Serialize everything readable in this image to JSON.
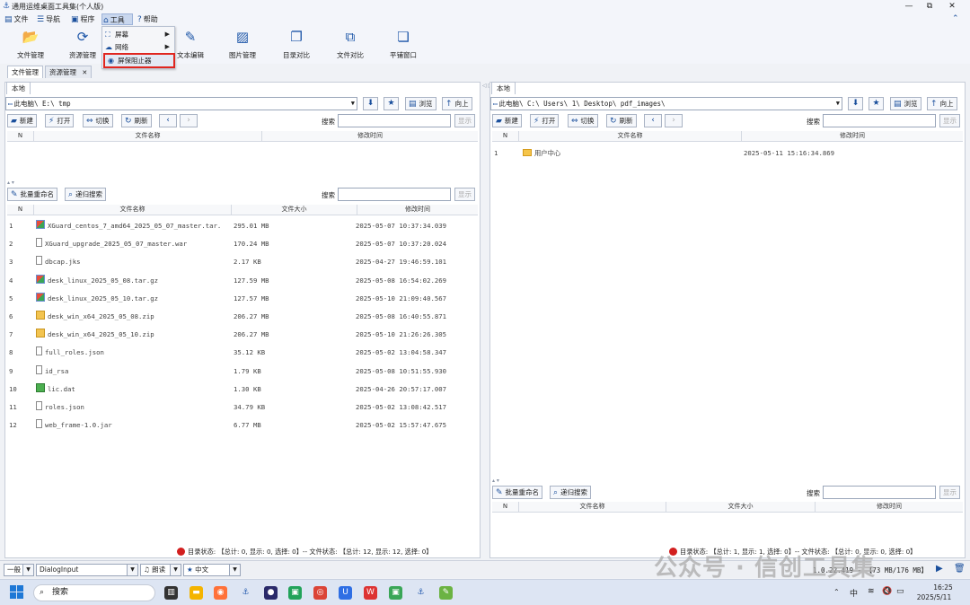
{
  "window": {
    "title": "通用运维桌面工具集(个人版)",
    "controls": [
      "—",
      "⧉",
      "✕"
    ]
  },
  "menubar": {
    "items": [
      {
        "label": "文件",
        "icon": "file-icon"
      },
      {
        "label": "导航",
        "icon": "list-icon"
      },
      {
        "label": "程序",
        "icon": "program-icon"
      },
      {
        "label": "工具",
        "icon": "tools-icon"
      },
      {
        "label": "帮助",
        "icon": "help-icon"
      }
    ]
  },
  "toolbar": {
    "items": [
      {
        "label": "文件管理",
        "icon": "folder-icon"
      },
      {
        "label": "资源管理",
        "icon": "resource-icon"
      },
      {
        "label": "文本编辑",
        "icon": "edit-icon"
      },
      {
        "label": "图片管理",
        "icon": "image-icon"
      },
      {
        "label": "目录对比",
        "icon": "dir-compare-icon"
      },
      {
        "label": "文件对比",
        "icon": "file-compare-icon"
      },
      {
        "label": "平铺窗口",
        "icon": "tile-window-icon"
      }
    ]
  },
  "dropdown": {
    "items": [
      {
        "label": "屏幕",
        "has_submenu": true
      },
      {
        "label": "网络",
        "has_submenu": true
      },
      {
        "label": "屏保阻止器",
        "has_submenu": false,
        "highlighted": true
      }
    ]
  },
  "tabs": [
    {
      "label": "文件管理",
      "selected": true
    },
    {
      "label": "资源管理",
      "closable": true
    }
  ],
  "left": {
    "subtab": "本地",
    "path": "此电脑\\ E:\\ tmp",
    "nav_buttons": {
      "browse": "浏览",
      "up": "向上"
    },
    "actions": {
      "new": "新建",
      "open": "打开",
      "switch": "切换",
      "refresh": "刷新"
    },
    "search_label": "搜索",
    "show_btn": "显示",
    "dir_header": {
      "n": "N",
      "name": "文件名称",
      "mtime": "修改时间"
    },
    "bottom_actions": {
      "rename": "批量重命名",
      "recursive": "递归搜索"
    },
    "file_header": {
      "n": "N",
      "name": "文件名称",
      "size": "文件大小",
      "mtime": "修改时间"
    },
    "files": [
      {
        "n": "1",
        "name": "XGuard_centos_7_amd64_2025_05_07_master.tar.",
        "size": "295.01 MB",
        "mtime": "2025-05-07 10:37:34.039",
        "type": "zip"
      },
      {
        "n": "2",
        "name": "XGuard_upgrade_2025_05_07_master.war",
        "size": "170.24 MB",
        "mtime": "2025-05-07 10:37:20.024",
        "type": "file"
      },
      {
        "n": "3",
        "name": "dbcap.jks",
        "size": "2.17 KB",
        "mtime": "2025-04-27 19:46:59.101",
        "type": "file"
      },
      {
        "n": "4",
        "name": "desk_linux_2025_05_08.tar.gz",
        "size": "127.59 MB",
        "mtime": "2025-05-08 16:54:02.269",
        "type": "zip"
      },
      {
        "n": "5",
        "name": "desk_linux_2025_05_10.tar.gz",
        "size": "127.57 MB",
        "mtime": "2025-05-10 21:09:40.567",
        "type": "zip"
      },
      {
        "n": "6",
        "name": "desk_win_x64_2025_05_08.zip",
        "size": "206.27 MB",
        "mtime": "2025-05-08 16:40:55.871",
        "type": "gz"
      },
      {
        "n": "7",
        "name": "desk_win_x64_2025_05_10.zip",
        "size": "206.27 MB",
        "mtime": "2025-05-10 21:26:26.305",
        "type": "gz"
      },
      {
        "n": "8",
        "name": "full_roles.json",
        "size": "35.12 KB",
        "mtime": "2025-05-02 13:04:58.347",
        "type": "file"
      },
      {
        "n": "9",
        "name": "id_rsa",
        "size": "1.79 KB",
        "mtime": "2025-05-08 10:51:55.930",
        "type": "file"
      },
      {
        "n": "10",
        "name": "lic.dat",
        "size": "1.30 KB",
        "mtime": "2025-04-26 20:57:17.007",
        "type": "dat"
      },
      {
        "n": "11",
        "name": "roles.json",
        "size": "34.79 KB",
        "mtime": "2025-05-02 13:08:42.517",
        "type": "file"
      },
      {
        "n": "12",
        "name": "web_frame-1.0.jar",
        "size": "6.77 MB",
        "mtime": "2025-05-02 15:57:47.675",
        "type": "file"
      }
    ],
    "status": "目录状态: 【总计: 0, 显示: 0, 选择: 0】-- 文件状态: 【总计: 12, 显示: 12, 选择: 0】"
  },
  "right": {
    "subtab": "本地",
    "path": "此电脑\\ C:\\ Users\\ 1\\ Desktop\\ pdf_images\\",
    "nav_buttons": {
      "browse": "浏览",
      "up": "向上"
    },
    "actions": {
      "new": "新建",
      "open": "打开",
      "switch": "切换",
      "refresh": "刷新"
    },
    "search_label": "搜索",
    "show_btn": "显示",
    "dir_header": {
      "n": "N",
      "name": "文件名称",
      "mtime": "修改时间"
    },
    "dirs": [
      {
        "n": "1",
        "name": "用户中心",
        "mtime": "2025-05-11 15:16:34.869"
      }
    ],
    "bottom_actions": {
      "rename": "批量重命名",
      "recursive": "递归搜索"
    },
    "file_header": {
      "n": "N",
      "name": "文件名称",
      "size": "文件大小",
      "mtime": "修改时间"
    },
    "status": "目录状态: 【总计: 1, 显示: 1, 选择: 0】-- 文件状态: 【总计: 0, 显示: 0, 选择: 0】"
  },
  "bottombar": {
    "level": "一般",
    "input": "DialogInput",
    "theme": "朗读",
    "lang": "中文",
    "net": "1.0.22.419 - 【73 MB/176 MB】"
  },
  "taskbar": {
    "search": "搜索",
    "time": "16:25",
    "date": "2025/5/11",
    "ime": "中"
  },
  "watermark": "公众号 · 信创工具集"
}
